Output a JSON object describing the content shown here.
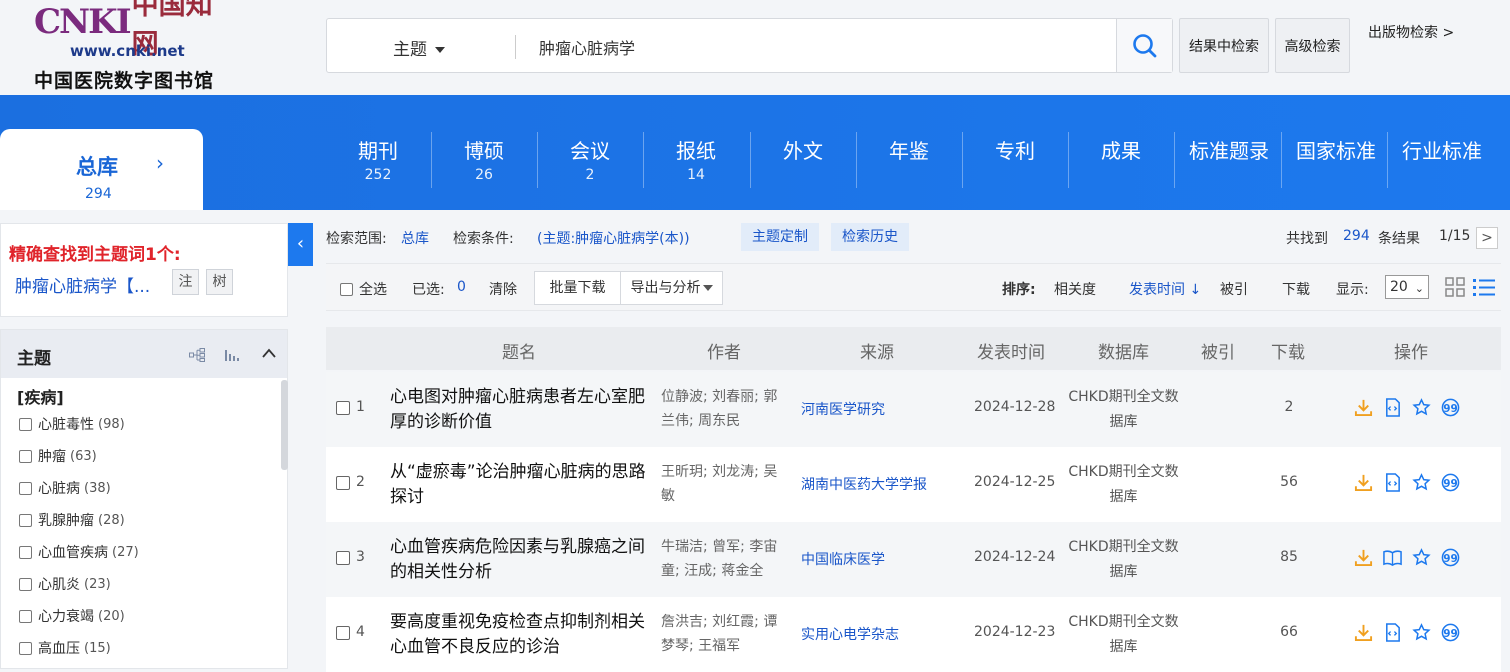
{
  "logo": {
    "brand": "CNKI",
    "cn": "中国知网",
    "url": "www.cnki.net",
    "library": "中国医院数字图书馆"
  },
  "search": {
    "type": "主题",
    "query": "肿瘤心脏病学",
    "in_results": "结果中检索",
    "advanced": "高级检索",
    "publication": "出版物检索 >"
  },
  "dbtabs": {
    "main": {
      "label": "总库",
      "count": "294"
    },
    "items": [
      {
        "label": "期刊",
        "count": "252"
      },
      {
        "label": "博硕",
        "count": "26"
      },
      {
        "label": "会议",
        "count": "2"
      },
      {
        "label": "报纸",
        "count": "14"
      },
      {
        "label": "外文",
        "count": ""
      },
      {
        "label": "年鉴",
        "count": ""
      },
      {
        "label": "专利",
        "count": ""
      },
      {
        "label": "成果",
        "count": ""
      },
      {
        "label": "标准题录",
        "count": ""
      },
      {
        "label": "国家标准",
        "count": ""
      },
      {
        "label": "行业标准",
        "count": ""
      }
    ]
  },
  "exact": {
    "title": "精确查找到主题词1个:",
    "term": "肿瘤心脏病学【...",
    "note_btn": "注",
    "tree_btn": "树"
  },
  "facet": {
    "title": "主题",
    "category": "[疾病]",
    "items": [
      {
        "label": "心脏毒性",
        "count": "(98)"
      },
      {
        "label": "肿瘤",
        "count": "(63)"
      },
      {
        "label": "心脏病",
        "count": "(38)"
      },
      {
        "label": "乳腺肿瘤",
        "count": "(28)"
      },
      {
        "label": "心血管疾病",
        "count": "(27)"
      },
      {
        "label": "心肌炎",
        "count": "(23)"
      },
      {
        "label": "心力衰竭",
        "count": "(20)"
      },
      {
        "label": "高血压",
        "count": "(15)"
      }
    ]
  },
  "criteria": {
    "scope_label": "检索范围:",
    "scope_value": "总库",
    "cond_label": "检索条件:",
    "cond_value": "(主题:肿瘤心脏病学(本))",
    "custom": "主题定制",
    "history": "检索历史",
    "found_prefix": "共找到",
    "found_count": "294",
    "found_suffix": "条结果",
    "page": "1/15",
    "next": ">"
  },
  "toolbar": {
    "select_all": "全选",
    "selected_label": "已选:",
    "selected_count": "0",
    "clear": "清除",
    "batch_download": "批量下载",
    "export": "导出与分析",
    "sort_label": "排序:",
    "sort_relevance": "相关度",
    "sort_date": "发表时间",
    "sort_cited": "被引",
    "sort_download": "下载",
    "display_label": "显示:",
    "display_value": "20"
  },
  "table": {
    "headers": [
      "题名",
      "作者",
      "来源",
      "发表时间",
      "数据库",
      "被引",
      "下载",
      "操作"
    ],
    "rows": [
      {
        "num": "1",
        "title": "心电图对肿瘤心脏病患者左心室肥厚的诊断价值",
        "authors": "位静波; 刘春丽; 郭兰伟; 周东民",
        "source": "河南医学研究",
        "date": "2024-12-28",
        "db": "CHKD期刊全文数据库",
        "cited": "",
        "downloads": "2"
      },
      {
        "num": "2",
        "title": "从“虚瘀毒”论治肿瘤心脏病的思路探讨",
        "authors": "王昕玥; 刘龙涛; 吴敏",
        "source": "湖南中医药大学学报",
        "date": "2024-12-25",
        "db": "CHKD期刊全文数据库",
        "cited": "",
        "downloads": "56"
      },
      {
        "num": "3",
        "title": "心血管疾病危险因素与乳腺癌之间的相关性分析",
        "authors": "牛瑞洁; 曾军; 李宙童; 汪成; 蒋金全",
        "source": "中国临床医学",
        "date": "2024-12-24",
        "db": "CHKD期刊全文数据库",
        "cited": "",
        "downloads": "85"
      },
      {
        "num": "4",
        "title": "要高度重视免疫检查点抑制剂相关心血管不良反应的诊治",
        "authors": "詹洪吉; 刘红霞; 谭梦琴; 王福军",
        "source": "实用心电学杂志",
        "date": "2024-12-23",
        "db": "CHKD期刊全文数据库",
        "cited": "",
        "downloads": "66"
      }
    ]
  },
  "colors": {
    "primary_blue": "#1d79ee",
    "link_blue": "#1a56c9",
    "red": "#e0242b",
    "download_orange": "#f0a020"
  }
}
